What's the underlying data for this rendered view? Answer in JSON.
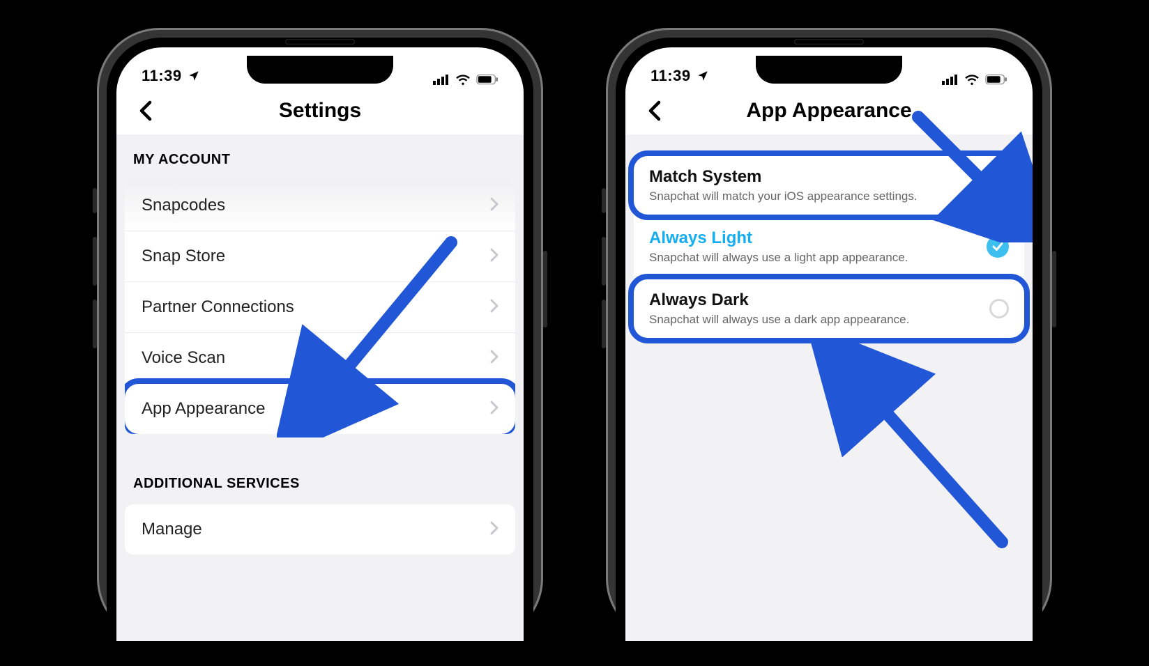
{
  "status": {
    "time": "11:39"
  },
  "left_phone": {
    "title": "Settings",
    "section1_header": "MY ACCOUNT",
    "rows": {
      "snapcodes": "Snapcodes",
      "snap_store": "Snap Store",
      "partner_connections": "Partner Connections",
      "voice_scan": "Voice Scan",
      "app_appearance": "App Appearance"
    },
    "section2_header": "ADDITIONAL SERVICES",
    "rows2": {
      "manage": "Manage"
    }
  },
  "right_phone": {
    "title": "App Appearance",
    "options": {
      "match_system": {
        "title": "Match System",
        "desc": "Snapchat will match your iOS appearance settings."
      },
      "always_light": {
        "title": "Always Light",
        "desc": "Snapchat will always use a light app appearance."
      },
      "always_dark": {
        "title": "Always Dark",
        "desc": "Snapchat will always use a dark app appearance."
      }
    }
  }
}
